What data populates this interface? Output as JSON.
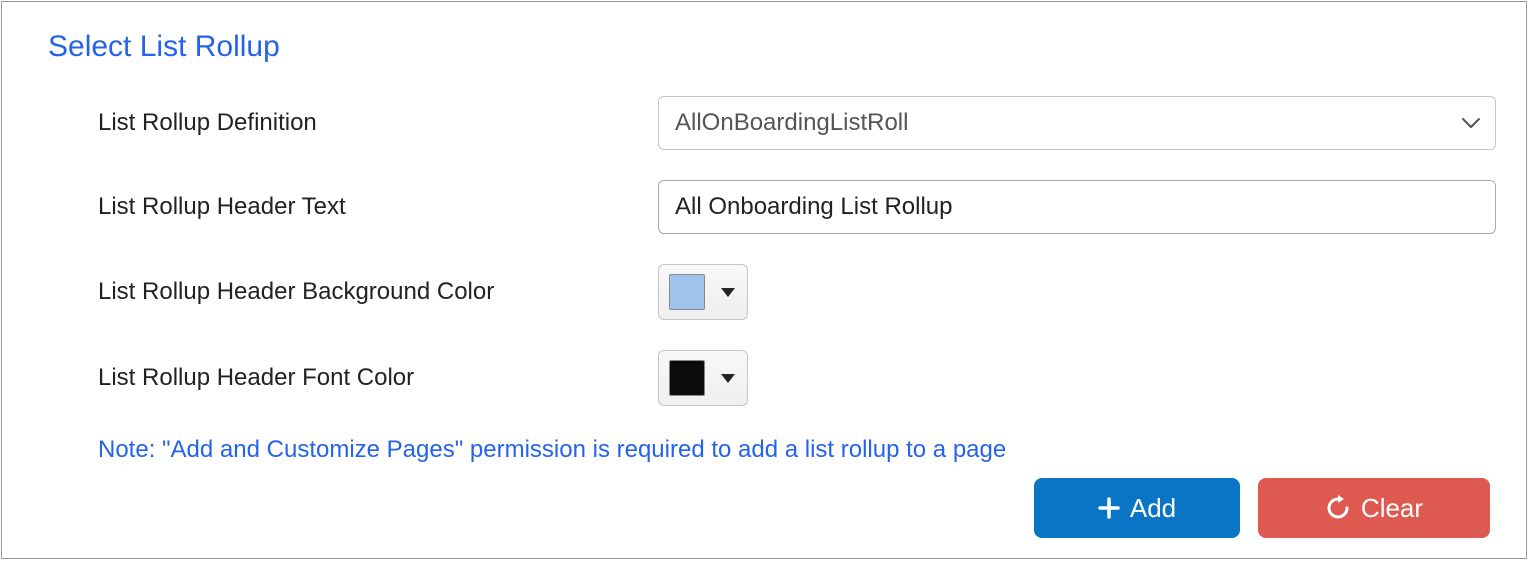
{
  "section": {
    "title": "Select List Rollup"
  },
  "form": {
    "definition": {
      "label": "List Rollup Definition",
      "value": "AllOnBoardingListRoll"
    },
    "header_text": {
      "label": "List Rollup Header Text",
      "value": "All Onboarding List Rollup"
    },
    "bg_color": {
      "label": "List Rollup Header Background Color",
      "value": "#9fc4ed"
    },
    "font_color": {
      "label": "List Rollup Header Font Color",
      "value": "#0b0b0b"
    }
  },
  "note": "Note: \"Add and Customize Pages\" permission is required to add a list rollup to a page",
  "buttons": {
    "add": "Add",
    "clear": "Clear"
  }
}
